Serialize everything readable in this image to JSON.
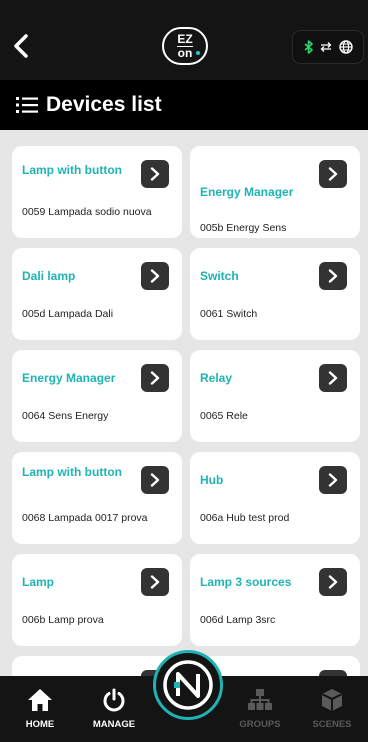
{
  "header": {
    "logo_line1": "EZ",
    "logo_line2": "on"
  },
  "titlebar": {
    "title": "Devices list"
  },
  "devices": [
    {
      "type": "Lamp with button",
      "name": "0059 Lampada sodio nuova"
    },
    {
      "type": "Energy Manager",
      "name": "005b Energy Sens"
    },
    {
      "type": "Dali lamp",
      "name": "005d Lampada Dali"
    },
    {
      "type": "Switch",
      "name": "0061 Switch"
    },
    {
      "type": "Energy Manager",
      "name": "0064 Sens Energy"
    },
    {
      "type": "Relay",
      "name": "0065 Rele"
    },
    {
      "type": "Lamp with button",
      "name": "0068 Lampada 0017 prova"
    },
    {
      "type": "Hub",
      "name": "006a Hub test prod"
    },
    {
      "type": "Lamp",
      "name": "006b Lamp prova"
    },
    {
      "type": "Lamp 3 sources",
      "name": "006d Lamp 3src"
    }
  ],
  "nav": {
    "home": "HOME",
    "manage": "MANAGE",
    "groups": "GROUPS",
    "scenes": "SCENES"
  },
  "icons": {
    "back": "chevron-left-icon",
    "bluetooth": "bluetooth-icon",
    "transfer": "arrows-exchange-icon",
    "globe": "globe-icon",
    "list": "list-icon",
    "home": "home-icon",
    "power": "power-icon",
    "groups": "hierarchy-icon",
    "scenes": "cube-icon"
  },
  "colors": {
    "accent": "#1fb3b3",
    "bluetooth": "#2ed36b",
    "nav_active": "#ffffff",
    "nav_inactive": "#5a5a5a"
  }
}
